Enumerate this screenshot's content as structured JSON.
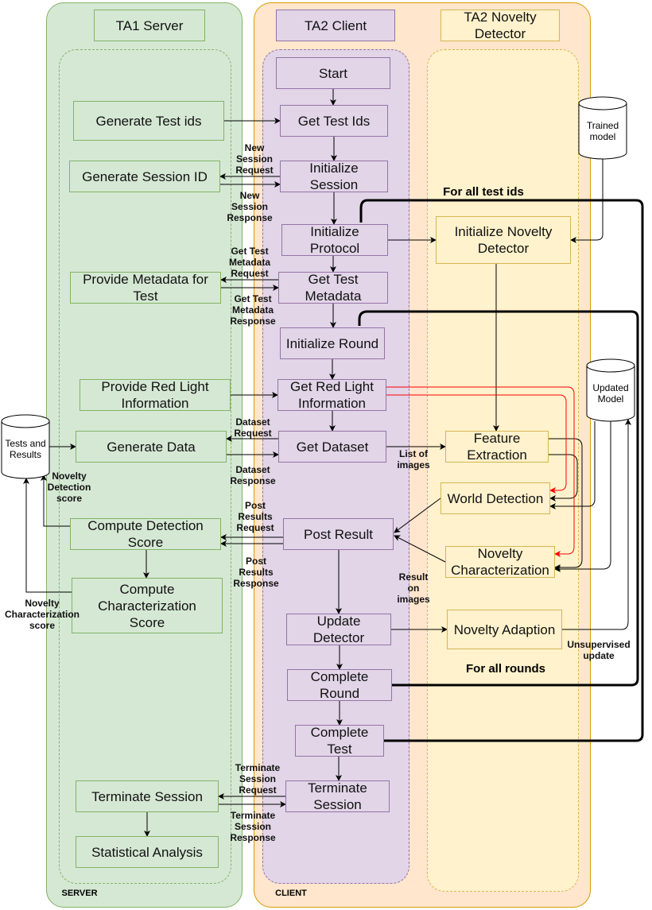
{
  "lanes": {
    "server": "TA1 Server",
    "client": "TA2 Client",
    "detector": "TA2 Novelty Detector",
    "server_footer": "SERVER",
    "client_footer": "CLIENT"
  },
  "server": [
    "Generate Test ids",
    "Generate Session ID",
    "Provide Metadata for Test",
    "Provide Red Light Information",
    "Generate Data",
    "Compute Detection Score",
    "Compute Characterization Score",
    "Terminate Session",
    "Statistical Analysis"
  ],
  "client": [
    "Start",
    "Get Test Ids",
    "Initialize Session",
    "Initialize Protocol",
    "Get Test Metadata",
    "Initialize Round",
    "Get Red Light Information",
    "Get Dataset",
    "Post Result",
    "Update Detector",
    "Complete Round",
    "Complete Test",
    "Terminate Session"
  ],
  "detector": [
    "Initialize Novelty Detector",
    "Feature Extraction",
    "World Detection",
    "Novelty Characterization",
    "Novelty Adaption"
  ],
  "stores": [
    "Trained model",
    "Updated Model",
    "Tests and Results"
  ],
  "labels": [
    "New Session Request",
    "New Session Response",
    "Get Test Metadata Request",
    "Get Test Metadata Response",
    "Dataset Request",
    "Dataset Response",
    "List of images",
    "Post Results Request",
    "Post Results Response",
    "Result on images",
    "Novelty Detection score",
    "Novelty Characterization score",
    "Unsupervised update",
    "Terminate Session Request",
    "Terminate Session Response"
  ],
  "loops": {
    "tests": "For all test ids",
    "rounds": "For all rounds"
  },
  "colors": {
    "server": "#d5e8d4",
    "client_lane": "#ffe6cc",
    "client": "#e1d5e7",
    "detector": "#fff2cc",
    "red_flow": "#ff0000"
  }
}
